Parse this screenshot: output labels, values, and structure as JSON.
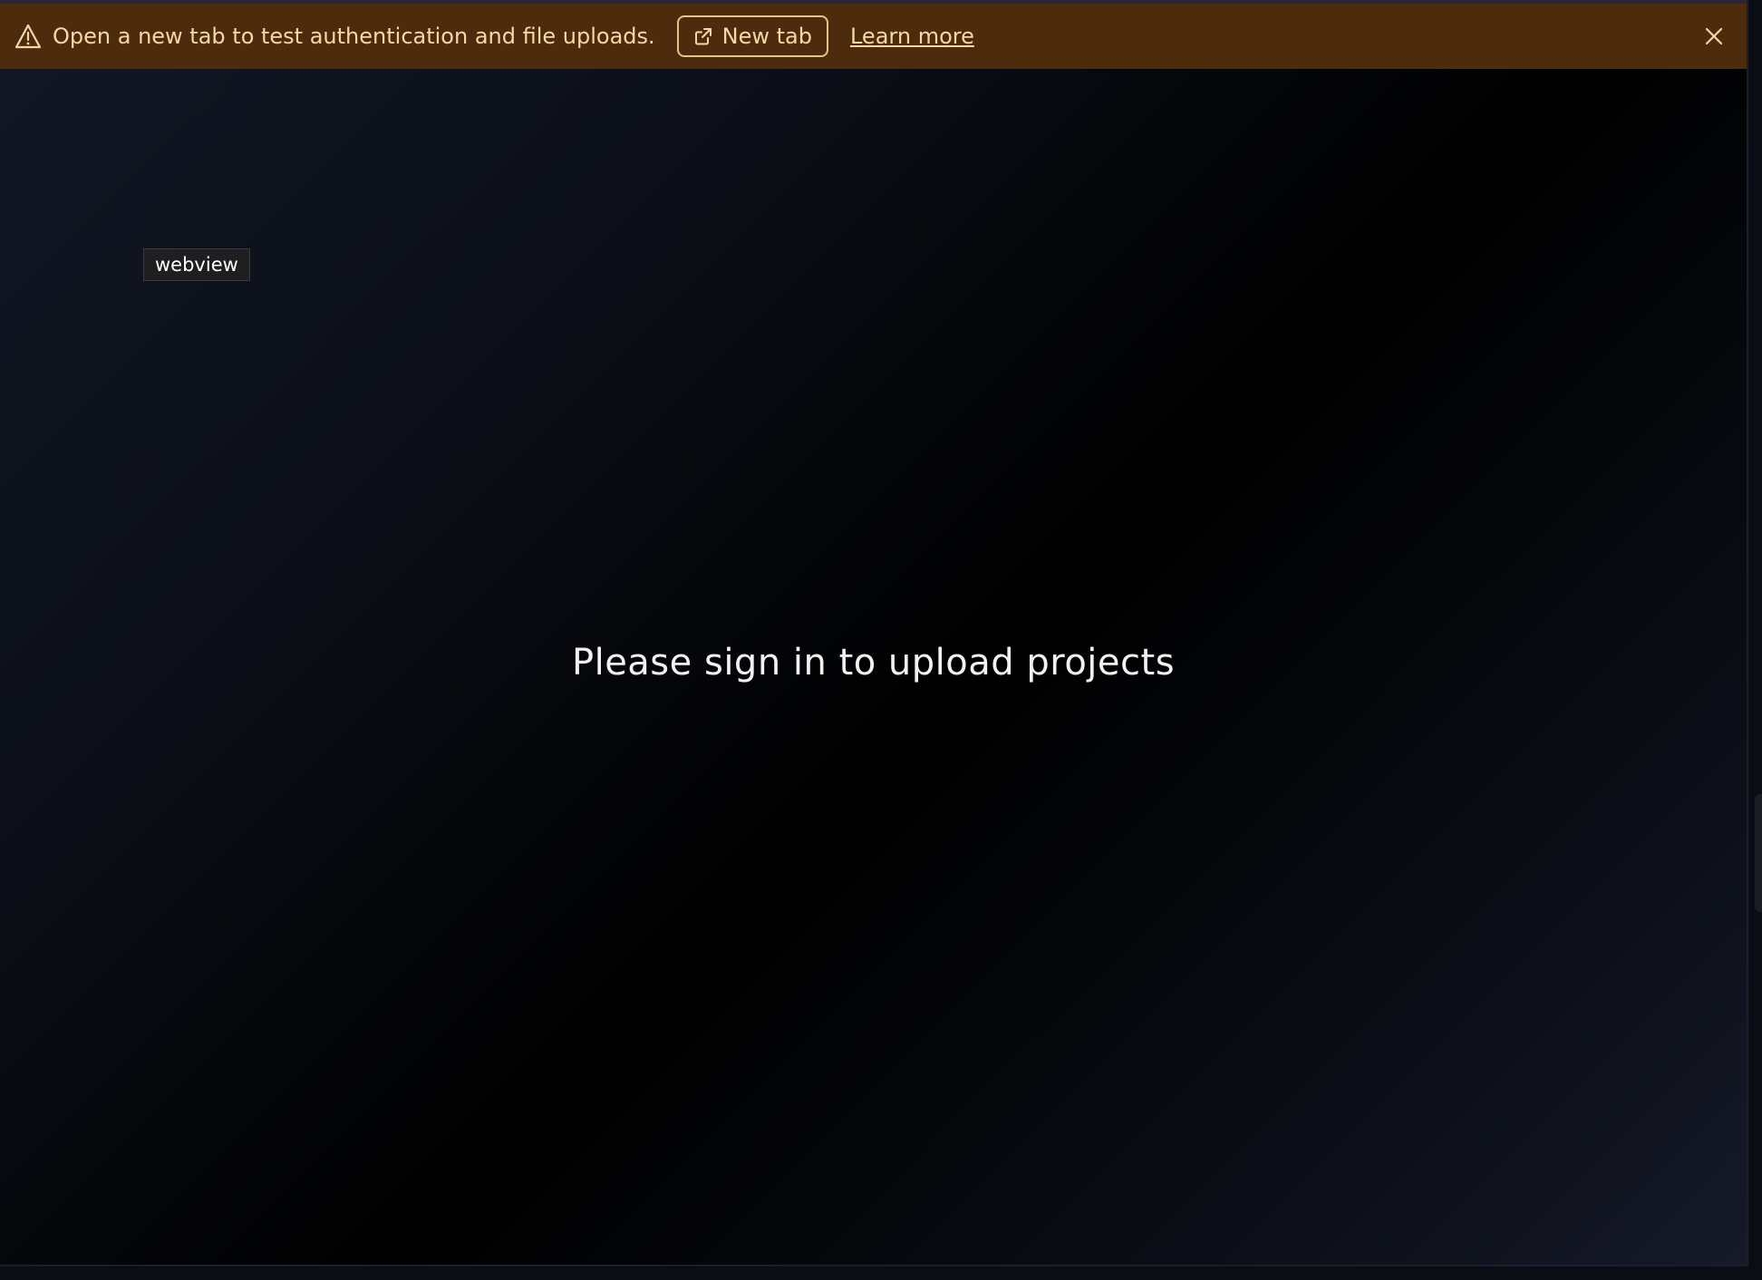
{
  "banner": {
    "message": "Open a new tab to test authentication and file uploads.",
    "new_tab_label": "New tab",
    "learn_more_label": "Learn more",
    "icons": {
      "warning": "warning-icon",
      "external_link": "external-link-icon",
      "close": "close-icon"
    },
    "colors": {
      "background": "#4d2c0d",
      "text": "#f5d7a8"
    }
  },
  "webview_tag": "webview",
  "main": {
    "message": "Please sign in to upload projects"
  }
}
